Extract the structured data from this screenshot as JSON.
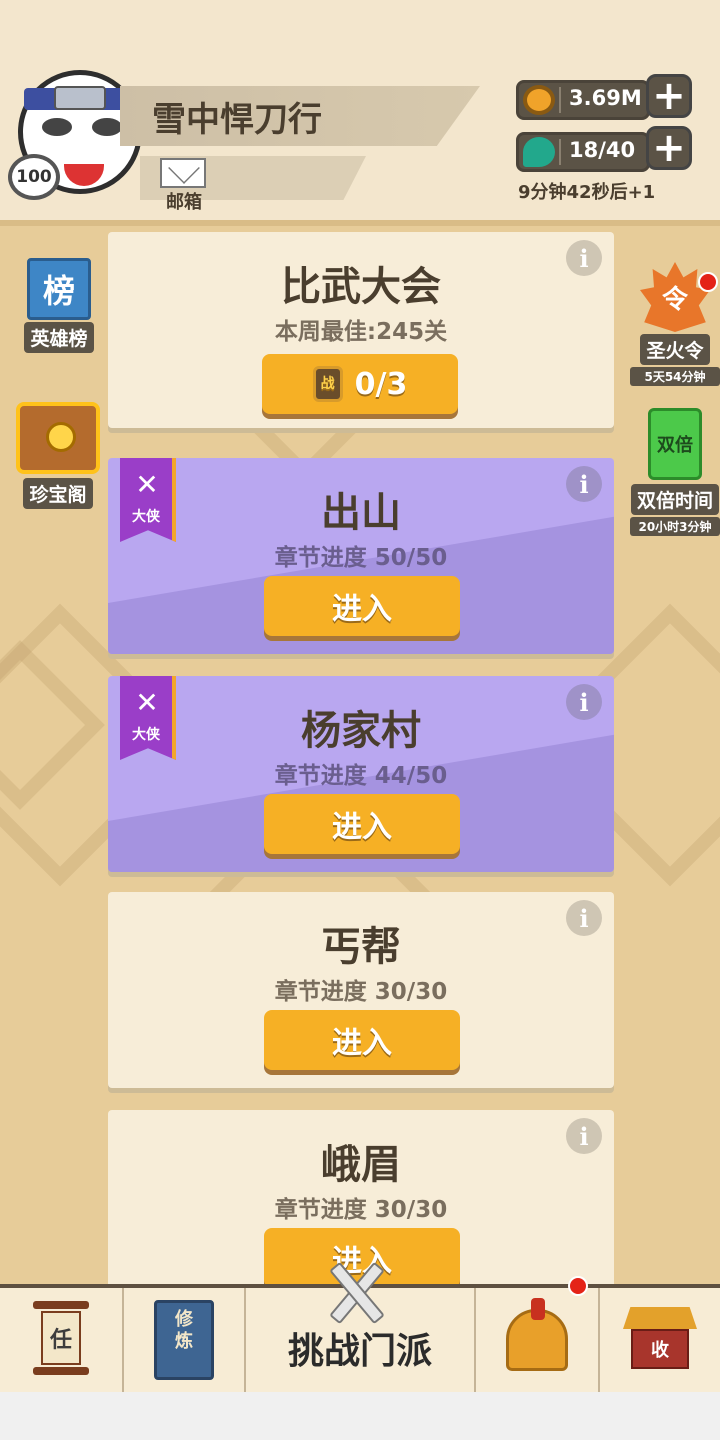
{
  "player": {
    "name": "雪中悍刀行",
    "level": "100",
    "mail_label": "邮箱"
  },
  "resources": {
    "coins": "3.69M",
    "stamina": "18/40",
    "stamina_timer": "9分钟42秒后+1",
    "plus": "+"
  },
  "left_side": {
    "rank_glyph": "榜",
    "rank_label": "英雄榜",
    "treasure_label": "珍宝阁"
  },
  "right_side": {
    "token_glyph": "令",
    "token_label": "圣火令",
    "token_timer": "5天54分钟",
    "double_glyph": "双倍",
    "double_label": "双倍时间",
    "double_timer": "20小时3分钟"
  },
  "arena": {
    "title": "比武大会",
    "best": "本周最佳:245关",
    "ticket_glyph": "战",
    "count": "0/3"
  },
  "stages": [
    {
      "title": "出山",
      "progress": "章节进度 50/50",
      "button": "进入",
      "ribbon": "大侠"
    },
    {
      "title": "杨家村",
      "progress": "章节进度 44/50",
      "button": "进入",
      "ribbon": "大侠"
    },
    {
      "title": "丐帮",
      "progress": "章节进度 30/30",
      "button": "进入"
    },
    {
      "title": "峨眉",
      "progress": "章节进度 30/30",
      "button": "进入"
    }
  ],
  "info_glyph": "i",
  "bottom_nav": {
    "task_glyph": "任",
    "cultivate_glyph": "修\n炼",
    "main_label": "挑战门派",
    "shop_glyph": "收"
  },
  "colors": {
    "accent": "#f6b025",
    "purple_card": "#b9a7f0",
    "cream_card": "#f7edd8",
    "background": "#e7cc99"
  }
}
